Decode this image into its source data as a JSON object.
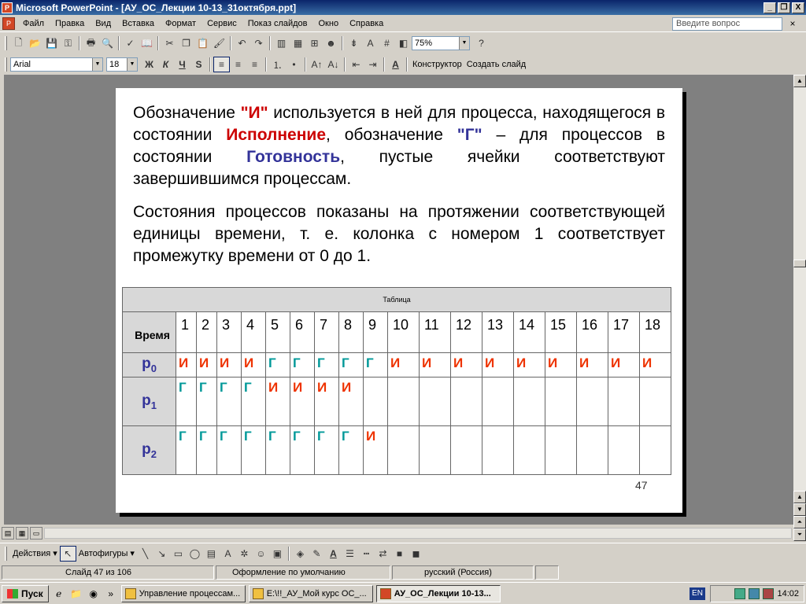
{
  "window": {
    "title": "Microsoft PowerPoint - [АУ_ОС_Лекции 10-13_31октября.ppt]",
    "minimize": "_",
    "restore": "❐",
    "close": "X"
  },
  "menu": {
    "items": [
      "Файл",
      "Правка",
      "Вид",
      "Вставка",
      "Формат",
      "Сервис",
      "Показ слайдов",
      "Окно",
      "Справка"
    ],
    "help_placeholder": "Введите вопрос",
    "close_doc": "×"
  },
  "standard_toolbar": {
    "zoom": "75%"
  },
  "format_toolbar": {
    "font": "Arial",
    "size": "18",
    "bold": "Ж",
    "italic": "К",
    "underline": "Ч",
    "shadow": "S",
    "designer": "Конструктор",
    "new_slide": "Создать слайд"
  },
  "slide": {
    "p1": {
      "t1": "Обозначение ",
      "q_i": "\"И\"",
      "t2": " используется в ней для процесса, находящегося в состоянии ",
      "exec": "Исполнение",
      "t3": ", обозначение ",
      "q_g": "\"Г\"",
      "t4": " – для процессов в состоянии ",
      "ready": "Готовность",
      "t5": ", пустые ячейки соответствуют завершившимся процессам."
    },
    "p2": "Состояния процессов показаны на протяжении соответствующей единицы времени, т. е. колонка с номером 1 соответствует промежутку времени от 0 до 1.",
    "table": {
      "caption": "Таблица",
      "time_header": "Время",
      "columns": [
        "1",
        "2",
        "3",
        "4",
        "5",
        "6",
        "7",
        "8",
        "9",
        "10",
        "11",
        "12",
        "13",
        "14",
        "15",
        "16",
        "17",
        "18"
      ],
      "rows": [
        {
          "label": "p",
          "sub": "0",
          "cells": [
            "И",
            "И",
            "И",
            "И",
            "Г",
            "Г",
            "Г",
            "Г",
            "Г",
            "И",
            "И",
            "И",
            "И",
            "И",
            "И",
            "И",
            "И",
            "И"
          ]
        },
        {
          "label": "p",
          "sub": "1",
          "cells": [
            "Г",
            "Г",
            "Г",
            "Г",
            "И",
            "И",
            "И",
            "И",
            "",
            "",
            "",
            "",
            "",
            "",
            "",
            "",
            "",
            ""
          ]
        },
        {
          "label": "p",
          "sub": "2",
          "cells": [
            "Г",
            "Г",
            "Г",
            "Г",
            "Г",
            "Г",
            "Г",
            "Г",
            "И",
            "",
            "",
            "",
            "",
            "",
            "",
            "",
            "",
            ""
          ]
        }
      ]
    },
    "number": "47"
  },
  "drawing_toolbar": {
    "actions": "Действия",
    "autoshapes": "Автофигуры"
  },
  "status": {
    "slide": "Слайд 47 из 106",
    "design": "Оформление по умолчанию",
    "language": "русский (Россия)"
  },
  "taskbar": {
    "start": "Пуск",
    "tasks": [
      "Управление процессам...",
      "E:\\!!_АУ_Мой курс ОС_...",
      "АУ_ОС_Лекции 10-13..."
    ],
    "lang": "EN",
    "clock": "14:02"
  }
}
